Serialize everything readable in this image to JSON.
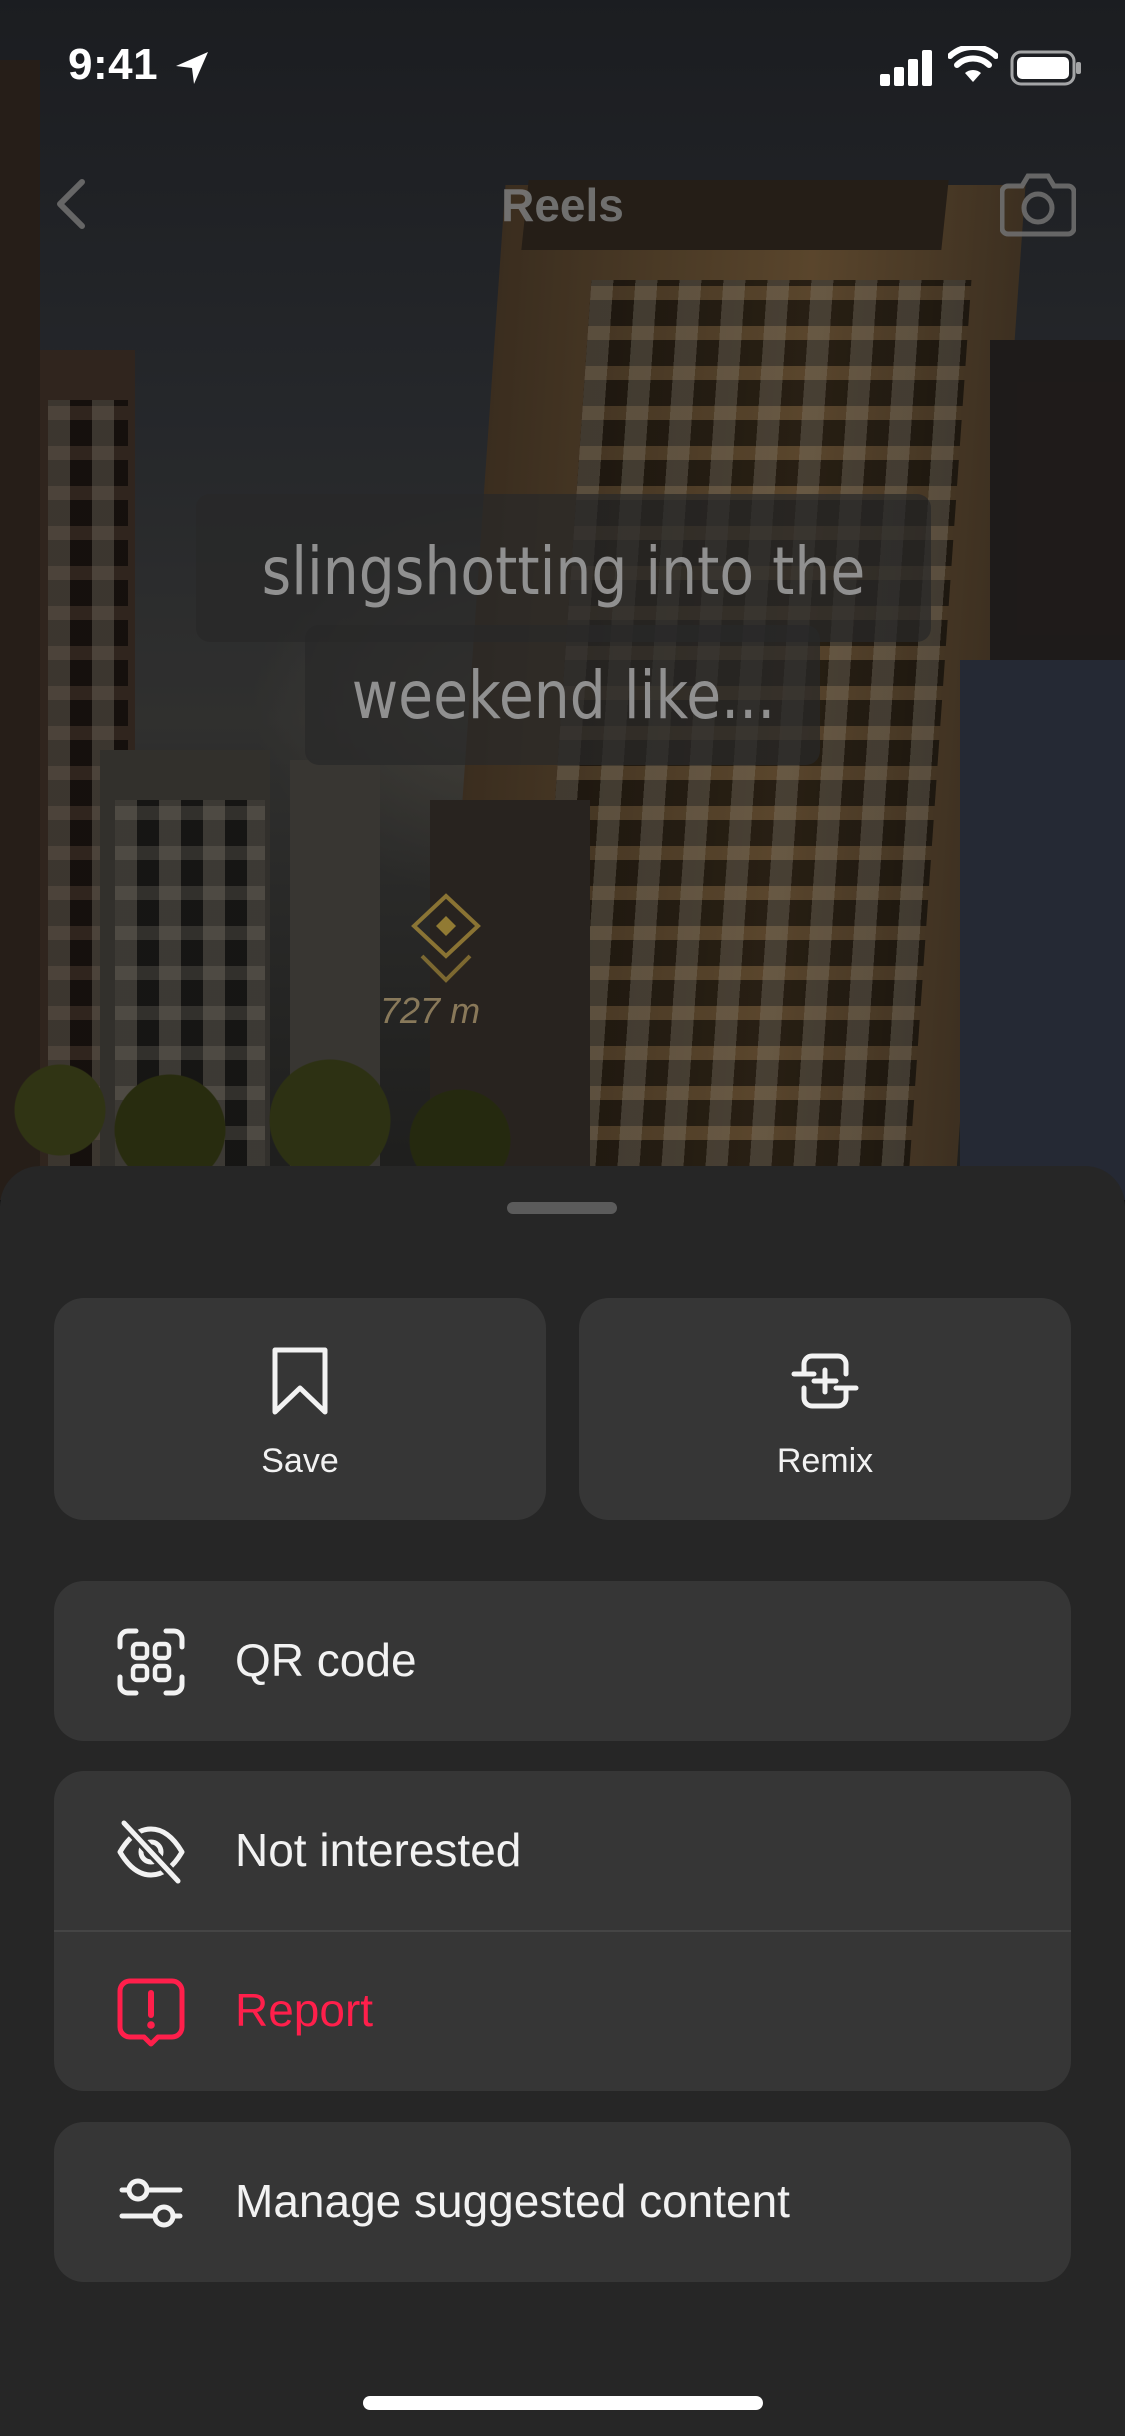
{
  "status_bar": {
    "time": "9:41",
    "icons": [
      "location-arrow-icon",
      "cellular-signal-icon",
      "wifi-icon",
      "battery-icon"
    ]
  },
  "reel": {
    "header_title": "Reels",
    "caption_line1": "slingshotting into the",
    "caption_line2": "weekend like...",
    "distance_label": "727 m",
    "icons": [
      "back-chevron-icon",
      "camera-icon",
      "waypoint-marker-icon"
    ]
  },
  "sheet": {
    "save_label": "Save",
    "remix_label": "Remix",
    "qr_label": "QR code",
    "not_interested_label": "Not interested",
    "report_label": "Report",
    "manage_label": "Manage suggested content",
    "icons": [
      "bookmark-icon",
      "remix-icon",
      "qr-code-icon",
      "eye-slash-icon",
      "report-alert-icon",
      "sliders-icon"
    ]
  },
  "colors": {
    "sheet_background": "#262626",
    "tile_background": "#363636",
    "text": "#f2f2f2",
    "destructive": "#ff1f4b"
  }
}
